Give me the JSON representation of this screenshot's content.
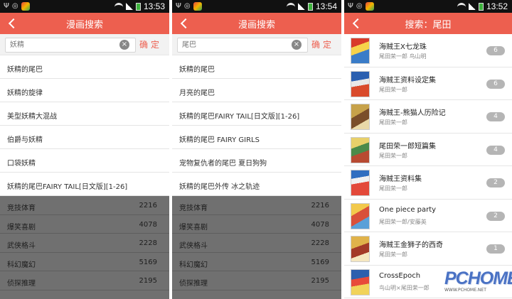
{
  "screens": [
    {
      "status": {
        "time": "13:53"
      },
      "header": {
        "title": "漫画搜索"
      },
      "search": {
        "value": "",
        "placeholder": "妖精",
        "confirm_label": "确定"
      },
      "suggestions": [
        "妖精的尾巴",
        "妖精的旋律",
        "美型妖精大混战",
        "伯爵与妖精",
        "口袋妖精",
        "妖精的尾巴FAIRY TAIL[日文版][1-26]"
      ]
    },
    {
      "status": {
        "time": "13:54"
      },
      "header": {
        "title": "漫画搜索"
      },
      "search": {
        "value": "",
        "placeholder": "尾巴",
        "confirm_label": "确定"
      },
      "suggestions": [
        "妖精的尾巴",
        "月亮的尾巴",
        "妖精的尾巴FAIRY TAIL[日文版][1-26]",
        "妖精的尾巴 FAIRY GIRLS",
        "宠物复仇者的尾巴 夏日狗狗",
        "妖精的尾巴外传 冰之轨迹"
      ]
    },
    {
      "status": {
        "time": "13:52"
      },
      "header": {
        "title": "搜索：尾田"
      },
      "results": [
        {
          "title": "海贼王X七龙珠",
          "author": "尾田荣一郎 鸟山明",
          "count": "6"
        },
        {
          "title": "海贼王资料设定集",
          "author": "尾田荣一郎",
          "count": "6"
        },
        {
          "title": "海贼王-熊猫人历险记",
          "author": "尾田荣一郎",
          "count": "4"
        },
        {
          "title": "尾田荣一郎短篇集",
          "author": "尾田荣一郎",
          "count": "4"
        },
        {
          "title": "海贼王资料集",
          "author": "尾田荣一郎",
          "count": "2"
        },
        {
          "title": "One piece party",
          "author": "尾田荣一郎/安藤英",
          "count": "2"
        },
        {
          "title": "海贼王金狮子的西奇",
          "author": "尾田荣一郎",
          "count": "1"
        },
        {
          "title": "CrossEpoch",
          "author": "鸟山明×尾田荣一郎",
          "count": ""
        }
      ]
    }
  ],
  "categories": [
    {
      "name": "竞技体育",
      "count": "2216"
    },
    {
      "name": "爆笑喜剧",
      "count": "4078"
    },
    {
      "name": "武侠格斗",
      "count": "2228"
    },
    {
      "name": "科幻魔幻",
      "count": "5169"
    },
    {
      "name": "侦探推理",
      "count": "2195"
    }
  ],
  "watermark": {
    "logo": "PCHOME",
    "url": "WWW.PCHOME.NET"
  },
  "colors": {
    "accent": "#ed5f4f",
    "status_bg": "#111111",
    "overlay": "#707070"
  },
  "icons": {
    "back": "chevron-left-icon",
    "clear": "clear-circle-icon",
    "wifi": "wifi-icon",
    "signal": "signal-icon",
    "battery": "battery-icon"
  }
}
